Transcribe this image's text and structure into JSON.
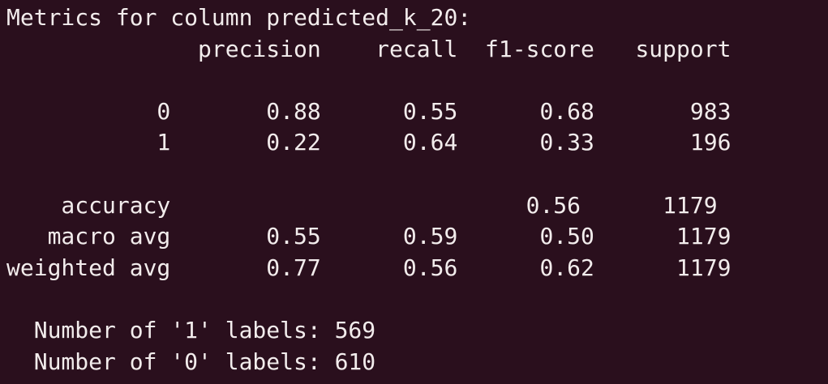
{
  "terminal": {
    "background_color": "#2a0f1d",
    "text_color": "#f2ecec",
    "lines": [
      "Metrics for column predicted_k_20:",
      "              precision    recall  f1-score   support",
      "",
      "           0       0.88      0.55      0.68       983",
      "           1       0.22      0.64      0.33       196",
      "",
      "    accuracy                          0.56      1179",
      "   macro avg       0.55      0.59      0.50      1179",
      "weighted avg       0.77      0.56      0.62      1179",
      "",
      "  Number of '1' labels: 569",
      "  Number of '0' labels: 610"
    ]
  }
}
